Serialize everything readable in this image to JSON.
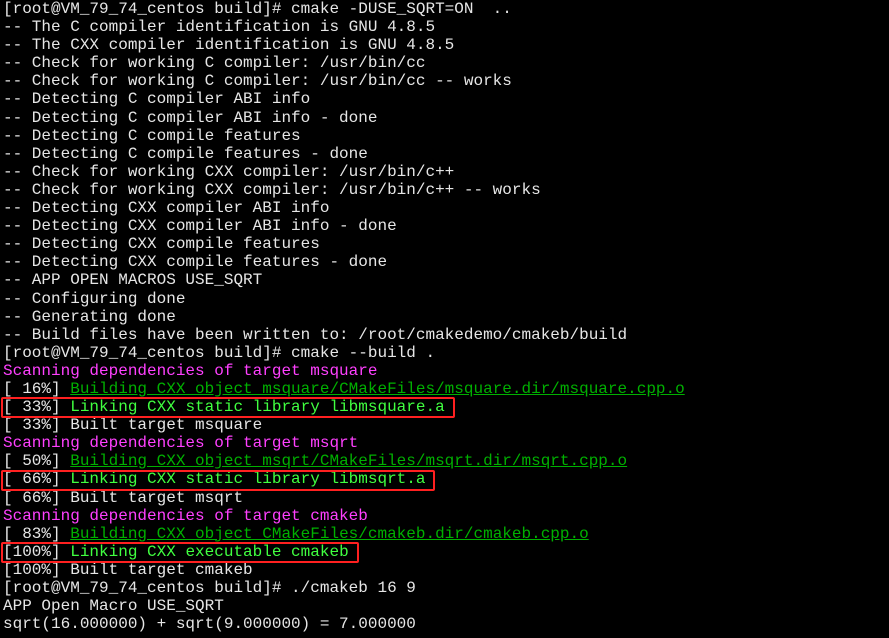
{
  "colors": {
    "background": "#000000",
    "text": "#e6e6e6",
    "scanning": "#ff40ff",
    "building": "#00b000",
    "linking": "#40ff40",
    "highlight": "#ff2020"
  },
  "lines": [
    {
      "t": "[root@VM_79_74_centos build]# cmake -DUSE_SQRT=ON  ..",
      "c": "white"
    },
    {
      "t": "-- The C compiler identification is GNU 4.8.5",
      "c": "white"
    },
    {
      "t": "-- The CXX compiler identification is GNU 4.8.5",
      "c": "white"
    },
    {
      "t": "-- Check for working C compiler: /usr/bin/cc",
      "c": "white"
    },
    {
      "t": "-- Check for working C compiler: /usr/bin/cc -- works",
      "c": "white"
    },
    {
      "t": "-- Detecting C compiler ABI info",
      "c": "white"
    },
    {
      "t": "-- Detecting C compiler ABI info - done",
      "c": "white"
    },
    {
      "t": "-- Detecting C compile features",
      "c": "white"
    },
    {
      "t": "-- Detecting C compile features - done",
      "c": "white"
    },
    {
      "t": "-- Check for working CXX compiler: /usr/bin/c++",
      "c": "white"
    },
    {
      "t": "-- Check for working CXX compiler: /usr/bin/c++ -- works",
      "c": "white"
    },
    {
      "t": "-- Detecting CXX compiler ABI info",
      "c": "white"
    },
    {
      "t": "-- Detecting CXX compiler ABI info - done",
      "c": "white"
    },
    {
      "t": "-- Detecting CXX compile features",
      "c": "white"
    },
    {
      "t": "-- Detecting CXX compile features - done",
      "c": "white"
    },
    {
      "t": "-- APP OPEN MACROS USE_SQRT",
      "c": "white"
    },
    {
      "t": "-- Configuring done",
      "c": "white"
    },
    {
      "t": "-- Generating done",
      "c": "white"
    },
    {
      "t": "-- Build files have been written to: /root/cmakedemo/cmakeb/build",
      "c": "white"
    },
    {
      "t": "[root@VM_79_74_centos build]# cmake --build .",
      "c": "white"
    },
    {
      "t": "Scanning dependencies of target msquare",
      "c": "magenta"
    },
    {
      "t": "[ 16%] ",
      "c": "white",
      "r": "Building CXX object msquare/CMakeFiles/msquare.dir/msquare.cpp.o",
      "rc": "dgreen"
    },
    {
      "t": "[ 33%] ",
      "c": "white",
      "r": "Linking CXX static library libmsquare.a",
      "rc": "bgreen",
      "box": true
    },
    {
      "t": "[ 33%] Built target msquare",
      "c": "white"
    },
    {
      "t": "Scanning dependencies of target msqrt",
      "c": "magenta"
    },
    {
      "t": "[ 50%] ",
      "c": "white",
      "r": "Building CXX object msqrt/CMakeFiles/msqrt.dir/msqrt.cpp.o",
      "rc": "dgreen"
    },
    {
      "t": "[ 66%] ",
      "c": "white",
      "r": "Linking CXX static library libmsqrt.a",
      "rc": "bgreen",
      "box": true
    },
    {
      "t": "[ 66%] Built target msqrt",
      "c": "white"
    },
    {
      "t": "Scanning dependencies of target cmakeb",
      "c": "magenta"
    },
    {
      "t": "[ 83%] ",
      "c": "white",
      "r": "Building CXX object CMakeFiles/cmakeb.dir/cmakeb.cpp.o",
      "rc": "dgreen"
    },
    {
      "t": "[100%] ",
      "c": "white",
      "r": "Linking CXX executable cmakeb",
      "rc": "bgreen",
      "box": true
    },
    {
      "t": "[100%] Built target cmakeb",
      "c": "white"
    },
    {
      "t": "[root@VM_79_74_centos build]# ./cmakeb 16 9",
      "c": "white"
    },
    {
      "t": "APP Open Macro USE_SQRT",
      "c": "white"
    },
    {
      "t": "sqrt(16.000000) + sqrt(9.000000) = 7.000000",
      "c": "white"
    }
  ]
}
